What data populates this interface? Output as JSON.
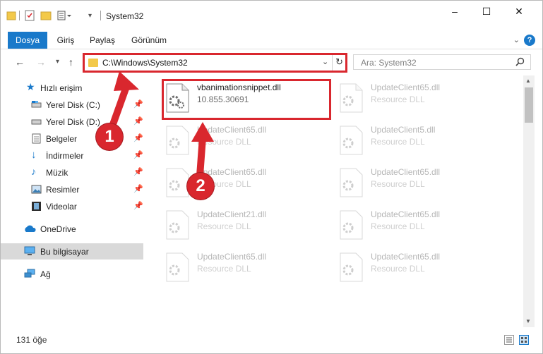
{
  "window": {
    "title": "System32",
    "controls": {
      "minimize": "–",
      "maximize": "☐",
      "close": "✕"
    }
  },
  "ribbon": {
    "tabs": [
      {
        "label": "Dosya",
        "active": true
      },
      {
        "label": "Giriş",
        "active": false
      },
      {
        "label": "Paylaş",
        "active": false
      },
      {
        "label": "Görünüm",
        "active": false
      }
    ],
    "help": "?"
  },
  "address": {
    "path": "C:\\Windows\\System32",
    "search_placeholder": "Ara: System32"
  },
  "sidebar": {
    "items": [
      {
        "label": "Hızlı erişim",
        "icon": "star-icon",
        "pinned": false
      },
      {
        "label": "Yerel Disk (C:)",
        "icon": "drive-icon",
        "pinned": true
      },
      {
        "label": "Yerel Disk (D:)",
        "icon": "drive-icon",
        "pinned": true
      },
      {
        "label": "Belgeler",
        "icon": "documents-icon",
        "pinned": true
      },
      {
        "label": "İndirmeler",
        "icon": "download-icon",
        "pinned": true
      },
      {
        "label": "Müzik",
        "icon": "music-icon",
        "pinned": true
      },
      {
        "label": "Resimler",
        "icon": "pictures-icon",
        "pinned": true
      },
      {
        "label": "Videolar",
        "icon": "video-icon",
        "pinned": true
      },
      {
        "label": "OneDrive",
        "icon": "cloud-icon",
        "pinned": false
      },
      {
        "label": "Bu bilgisayar",
        "icon": "computer-icon",
        "pinned": false,
        "selected": true
      },
      {
        "label": "Ağ",
        "icon": "network-icon",
        "pinned": false
      }
    ]
  },
  "files": [
    {
      "name": "vbanimationsnippet.dll",
      "sub": "10.855.30691",
      "highlighted": true
    },
    {
      "name": "UpdateClient65.dll",
      "sub": "Resource DLL"
    },
    {
      "name": "UpdateClient65.dll",
      "sub": "Resource DLL"
    },
    {
      "name": "UpdateClient5.dll",
      "sub": "Resource DLL"
    },
    {
      "name": "UpdateClient65.dll",
      "sub": "Resource DLL"
    },
    {
      "name": "UpdateClient65.dll",
      "sub": "Resource DLL"
    },
    {
      "name": "UpdateClient21.dll",
      "sub": "Resource DLL"
    },
    {
      "name": "UpdateClient65.dll",
      "sub": "Resource DLL"
    },
    {
      "name": "UpdateClient65.dll",
      "sub": "Resource DLL"
    },
    {
      "name": "UpdateClient65.dll",
      "sub": "Resource DLL"
    }
  ],
  "status": {
    "count": "131 öğe"
  },
  "callouts": {
    "one": "1",
    "two": "2"
  },
  "colors": {
    "accent": "#1979ca",
    "highlight": "#d9272e",
    "folder": "#f3c94a"
  }
}
